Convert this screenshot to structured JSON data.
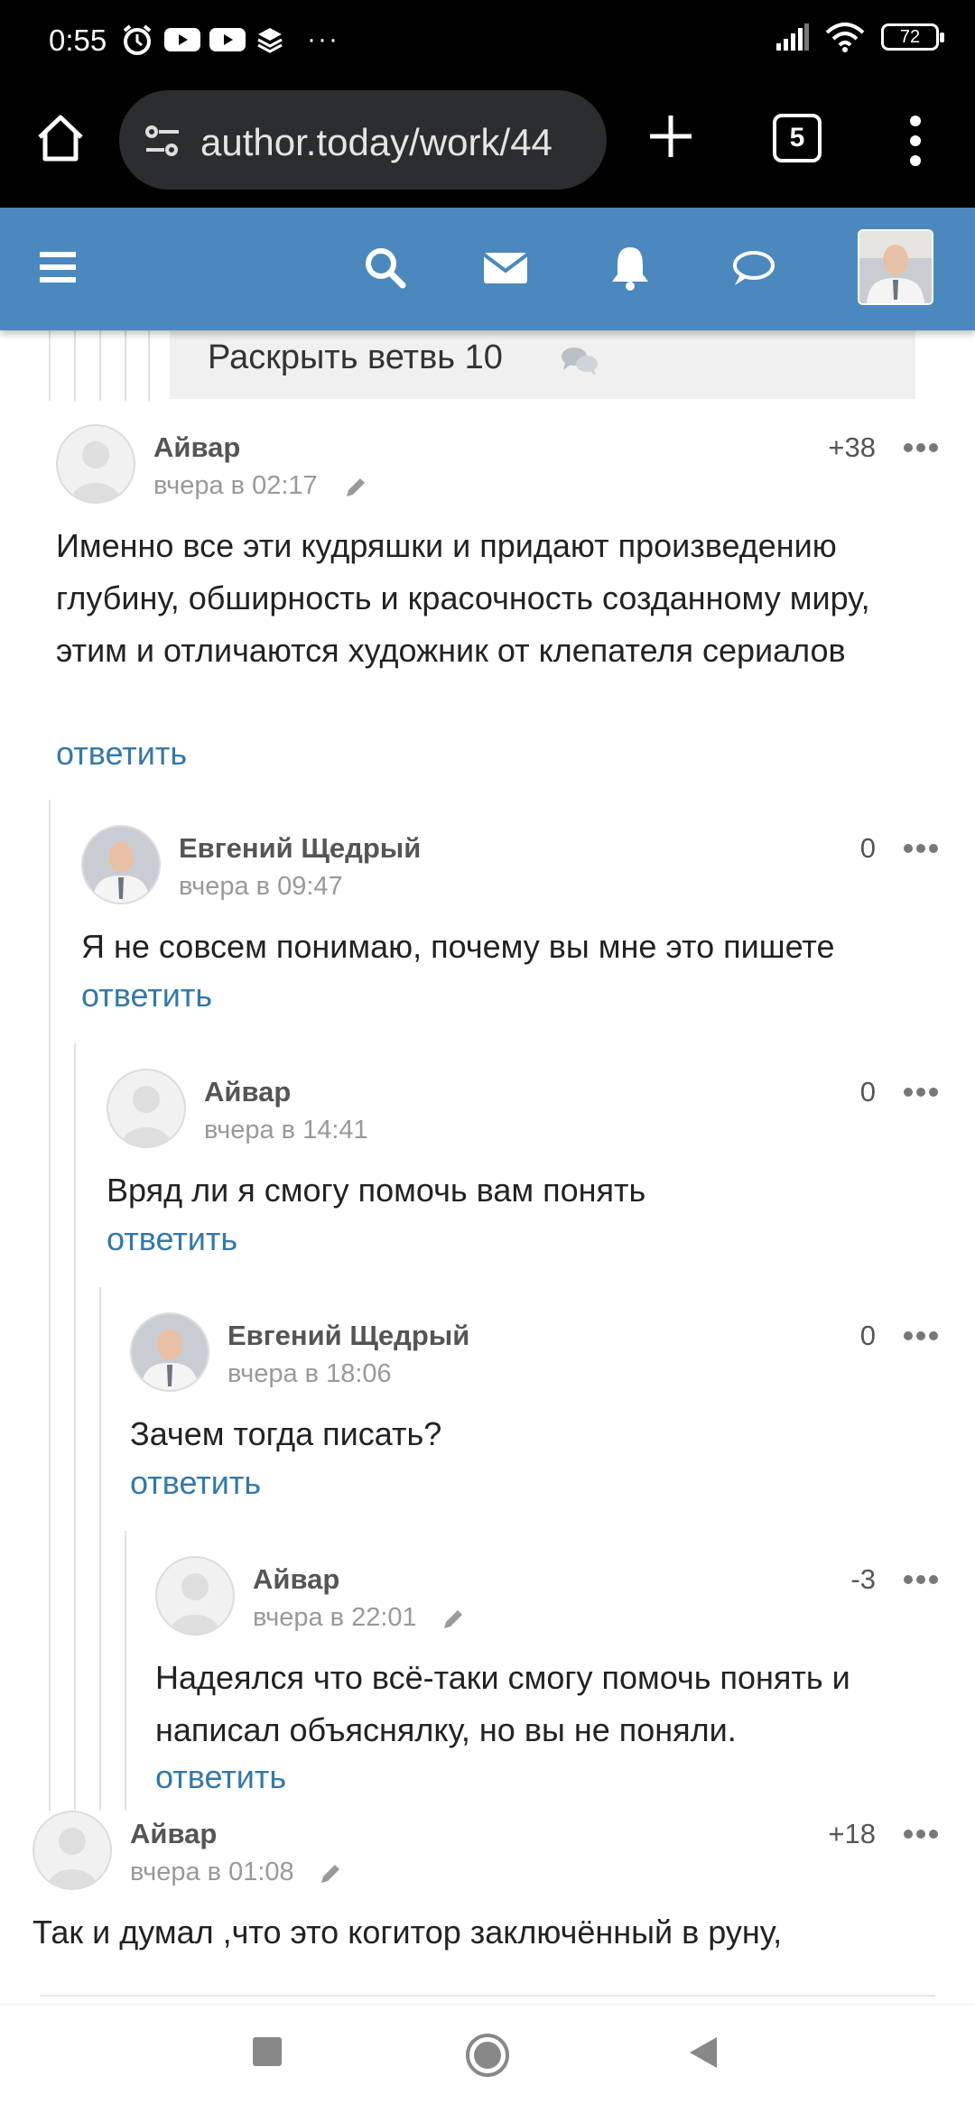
{
  "status": {
    "time": "0:55",
    "more": "···",
    "battery": "72"
  },
  "browser": {
    "url": "author.today/work/44",
    "tab_count": "5"
  },
  "expand_branch": {
    "label": "Раскрыть ветвь 10"
  },
  "comments": [
    {
      "author": "Айвар",
      "date": "вчера в 02:17",
      "score": "+38",
      "text": "Именно все эти кудряшки и придают произведению глубину, обширность и красочность созданному миру, этим  и отличаются художник от клепателя сериалов",
      "reply": "ответить"
    },
    {
      "author": "Евгений Щедрый",
      "date": "вчера в 09:47",
      "score": "0",
      "text": "Я не совсем понимаю, почему вы мне это пишете",
      "reply": "ответить"
    },
    {
      "author": "Айвар",
      "date": "вчера в 14:41",
      "score": "0",
      "text": "Вряд ли я смогу помочь вам понять",
      "reply": "ответить"
    },
    {
      "author": "Евгений Щедрый",
      "date": "вчера в 18:06",
      "score": "0",
      "text": "Зачем тогда писать?",
      "reply": "ответить"
    },
    {
      "author": "Айвар",
      "date": "вчера в 22:01",
      "score": "-3",
      "text": "Надеялся что всё-таки смогу помочь понять и написал объяснялку, но вы не поняли.",
      "reply": "ответить"
    },
    {
      "author": "Айвар",
      "date": "вчера в 01:08",
      "score": "+18",
      "text": "Так и думал ,что это когитор заключённый в руну,",
      "reply": ""
    }
  ]
}
